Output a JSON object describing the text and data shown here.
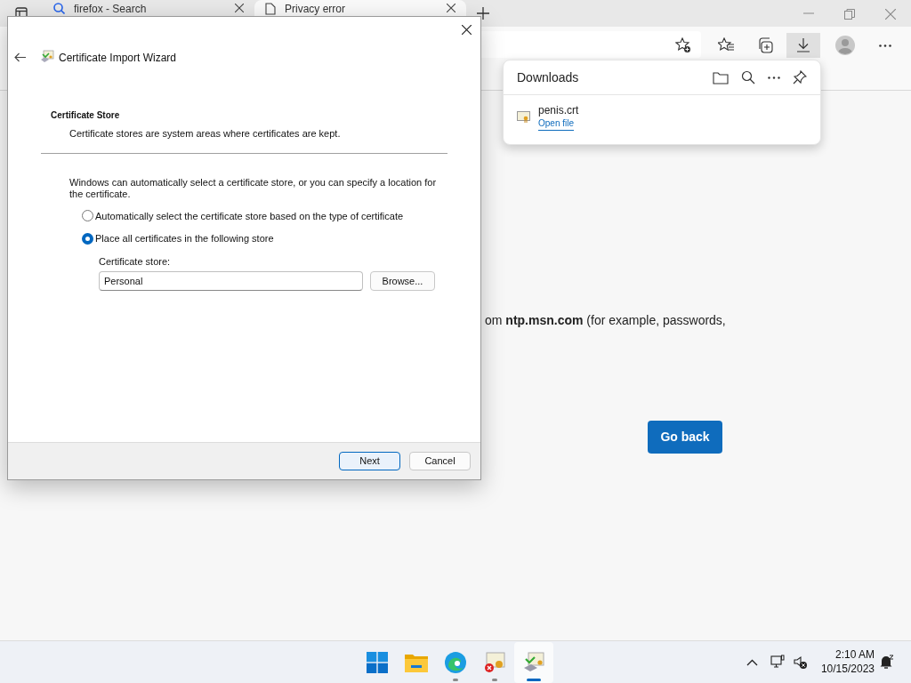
{
  "browser": {
    "tabs": [
      {
        "label": "firefox - Search",
        "kind": "search",
        "selected": false
      },
      {
        "label": "Privacy error",
        "kind": "page",
        "selected": true
      }
    ]
  },
  "downloads": {
    "title": "Downloads",
    "items": [
      {
        "name": "penis.crt",
        "action": "Open file"
      }
    ]
  },
  "page": {
    "message": "om **ntp.msn.com** (for example, passwords,",
    "button": "Go back"
  },
  "dialog": {
    "title": "Certificate Import Wizard",
    "heading": "Certificate Store",
    "subheading": "Certificate stores are system areas where certificates are kept.",
    "intro": "Windows can automatically select a certificate store, or you can specify a location for the certificate.",
    "options": [
      {
        "label": "Automatically select the certificate store based on the type of certificate",
        "selected": false
      },
      {
        "label": "Place all certificates in the following store",
        "selected": true
      }
    ],
    "store_label": "Certificate store:",
    "store_value": "Personal",
    "browse": "Browse...",
    "buttons": [
      {
        "label": "Next",
        "focused": true
      },
      {
        "label": "Cancel",
        "focused": false
      }
    ]
  },
  "taskbar": {
    "apps": [
      {
        "kind": "start",
        "running": false,
        "selected": false
      },
      {
        "kind": "folder",
        "running": false,
        "selected": false
      },
      {
        "kind": "edge",
        "running": true,
        "selected": false
      },
      {
        "kind": "cert-error",
        "running": true,
        "selected": false
      },
      {
        "kind": "cert-wizard",
        "running": true,
        "selected": true
      }
    ],
    "time": "2:10 AM",
    "date": "10/15/2023"
  }
}
